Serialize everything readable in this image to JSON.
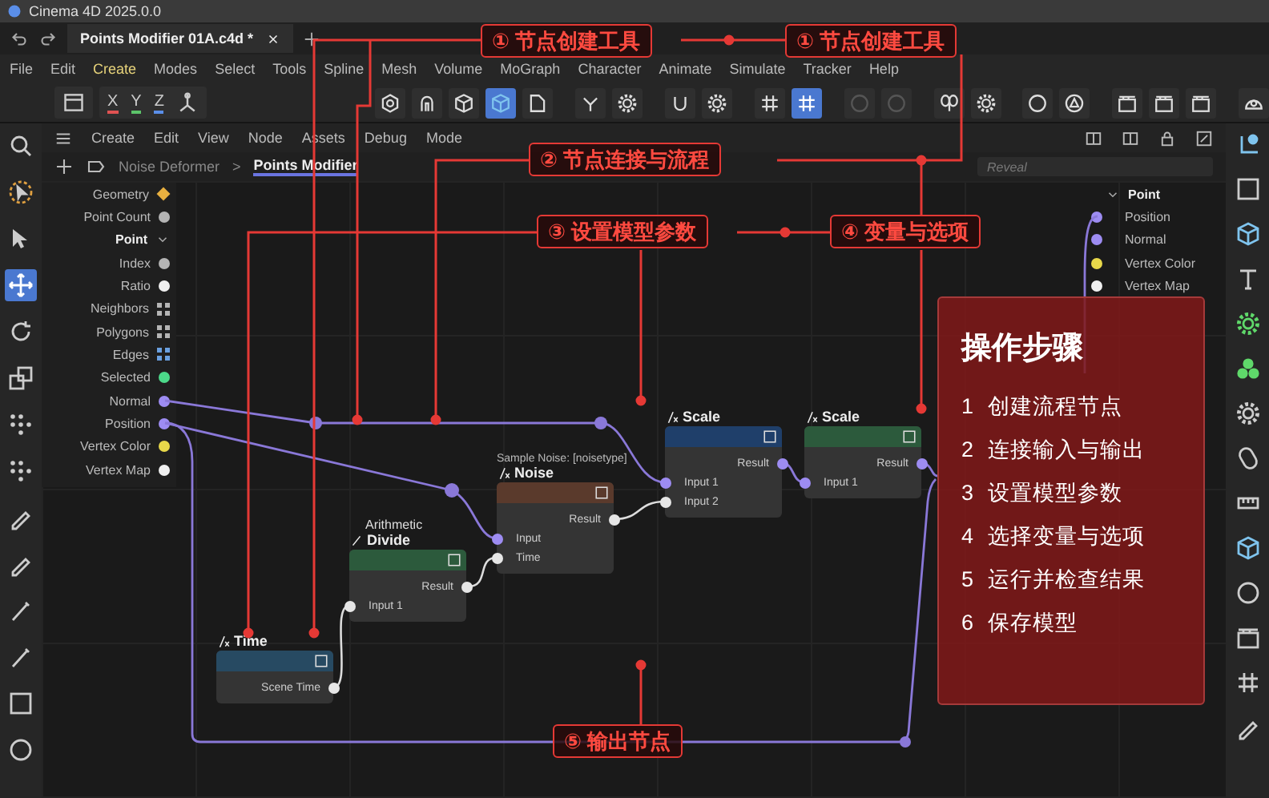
{
  "app": {
    "title": "Cinema 4D 2025.0.0"
  },
  "tabs": [
    {
      "label": "Points Modifier 01A.c4d *",
      "selected": true
    }
  ],
  "menu": [
    {
      "label": "File",
      "selected": false
    },
    {
      "label": "Edit",
      "selected": false
    },
    {
      "label": "Create",
      "selected": true
    },
    {
      "label": "Modes",
      "selected": false
    },
    {
      "label": "Select",
      "selected": false
    },
    {
      "label": "Tools",
      "selected": false
    },
    {
      "label": "Spline",
      "selected": false
    },
    {
      "label": "Mesh",
      "selected": false
    },
    {
      "label": "Volume",
      "selected": false
    },
    {
      "label": "MoGraph",
      "selected": false
    },
    {
      "label": "Character",
      "selected": false
    },
    {
      "label": "Animate",
      "selected": false
    },
    {
      "label": "Simulate",
      "selected": false
    },
    {
      "label": "Tracker",
      "selected": false
    },
    {
      "label": "Help",
      "selected": false
    }
  ],
  "toolbar": {
    "axes": [
      {
        "label": "X",
        "color": "#e05252"
      },
      {
        "label": "Y",
        "color": "#5cc46a"
      },
      {
        "label": "Z",
        "color": "#5a8ee8"
      }
    ],
    "tools": [
      {
        "selected": false
      },
      {
        "selected": false
      },
      {
        "selected": false
      },
      {
        "selected": true
      },
      {
        "selected": false
      },
      {
        "selected": false
      },
      {
        "selected": false
      },
      {
        "selected": false
      },
      {
        "selected": false
      },
      {
        "selected": false
      },
      {
        "selected": true
      },
      {
        "selected": false
      },
      {
        "selected": false
      },
      {
        "selected": false
      },
      {
        "selected": false
      },
      {
        "selected": false
      },
      {
        "selected": false
      },
      {
        "selected": false
      },
      {
        "selected": false
      },
      {
        "selected": false
      },
      {
        "selected": false
      }
    ]
  },
  "left_toolbar": [
    {
      "selected": false
    },
    {
      "selected": false
    },
    {
      "selected": false
    },
    {
      "selected": true
    },
    {
      "selected": false
    },
    {
      "selected": false
    },
    {
      "selected": false
    },
    {
      "selected": false
    },
    {
      "selected": false
    },
    {
      "selected": false
    },
    {
      "selected": false
    },
    {
      "selected": false
    },
    {
      "selected": false
    },
    {
      "selected": false
    }
  ],
  "node_editor": {
    "menu": [
      "Create",
      "Edit",
      "View",
      "Node",
      "Assets",
      "Debug",
      "Mode"
    ],
    "breadcrumb": [
      {
        "label": "Noise Deformer",
        "selected": false
      },
      {
        "label": "Points Modifier",
        "selected": true
      }
    ],
    "separator": ">",
    "search": {
      "placeholder": "Reveal"
    }
  },
  "input_ports": [
    {
      "label": "Geometry",
      "kind": "diamond",
      "color": "#e8b040"
    },
    {
      "label": "Point Count",
      "kind": "dot",
      "color": "#b4b4b4"
    },
    {
      "label": "Point",
      "kind": "group",
      "expanded": true,
      "children": [
        {
          "label": "Index",
          "kind": "dot",
          "color": "#b4b4b4"
        },
        {
          "label": "Ratio",
          "kind": "dot",
          "color": "#f0f0f0"
        },
        {
          "label": "Neighbors",
          "kind": "grid",
          "color": "#b4b4b4"
        },
        {
          "label": "Polygons",
          "kind": "grid",
          "color": "#b4b4b4"
        },
        {
          "label": "Edges",
          "kind": "grid",
          "color": "#6aa0e0"
        },
        {
          "label": "Selected",
          "kind": "dot",
          "color": "#4cd98a"
        },
        {
          "label": "Normal",
          "kind": "dot",
          "color": "#9d8cf2"
        },
        {
          "label": "Position",
          "kind": "dot",
          "color": "#9d8cf2"
        },
        {
          "label": "Vertex Color",
          "kind": "dot",
          "color": "#e8d84a"
        },
        {
          "label": "Vertex Map",
          "kind": "dot",
          "color": "#f0f0f0"
        }
      ]
    }
  ],
  "output_ports": [
    {
      "label": "Point",
      "expanded": true,
      "children": [
        {
          "label": "Position",
          "color": "#9d8cf2"
        },
        {
          "label": "Normal",
          "color": "#9d8cf2"
        },
        {
          "label": "Vertex Color",
          "color": "#e8d84a"
        },
        {
          "label": "Vertex Map",
          "color": "#f0f0f0"
        }
      ]
    }
  ],
  "nodes": [
    {
      "title": "Time",
      "kind": "function",
      "color": "#274a62",
      "ports": [
        {
          "label": "Scene Time",
          "output": true,
          "kind": "float"
        }
      ]
    },
    {
      "title": "Divide",
      "subtitle": "Arithmetic",
      "kind": "arithmetic",
      "color": "#2c5a3c",
      "ports": [
        {
          "label": "Result",
          "output": true,
          "kind": "float"
        },
        {
          "label": "Input 1",
          "output": false,
          "kind": "float"
        }
      ]
    },
    {
      "title": "Noise",
      "caption": "Sample Noise: [noisetype]",
      "kind": "function",
      "color": "#5a3a2c",
      "ports": [
        {
          "label": "Result",
          "output": true,
          "kind": "float"
        },
        {
          "label": "Input",
          "output": false,
          "kind": "vector"
        },
        {
          "label": "Time",
          "output": false,
          "kind": "float"
        }
      ]
    },
    {
      "title": "Scale",
      "kind": "function",
      "color": "#1f3f6a",
      "ports": [
        {
          "label": "Result",
          "output": true,
          "kind": "vector"
        },
        {
          "label": "Input 1",
          "output": false,
          "kind": "vector"
        },
        {
          "label": "Input 2",
          "output": false,
          "kind": "float"
        }
      ]
    },
    {
      "title": "Scale",
      "kind": "function",
      "color": "#2c5a3c",
      "ports": [
        {
          "label": "Result",
          "output": true,
          "kind": "vector"
        },
        {
          "label": "Input 1",
          "output": false,
          "kind": "vector"
        }
      ]
    }
  ],
  "annotations": [
    {
      "label": "① 节点创建工具"
    },
    {
      "label": "① 节点创建工具"
    },
    {
      "label": "② 节点连接与流程"
    },
    {
      "label": "③ 设置模型参数"
    },
    {
      "label": "④ 变量与选项"
    },
    {
      "label": "⑤ 输出节点"
    }
  ],
  "steps_panel": {
    "title": "操作步骤",
    "steps": [
      {
        "number": "1",
        "text": "创建流程节点"
      },
      {
        "number": "2",
        "text": "连接输入与输出"
      },
      {
        "number": "3",
        "text": "设置模型参数"
      },
      {
        "number": "4",
        "text": "选择变量与选项"
      },
      {
        "number": "5",
        "text": "运行并检查结果"
      },
      {
        "number": "6",
        "text": "保存模型"
      }
    ]
  }
}
